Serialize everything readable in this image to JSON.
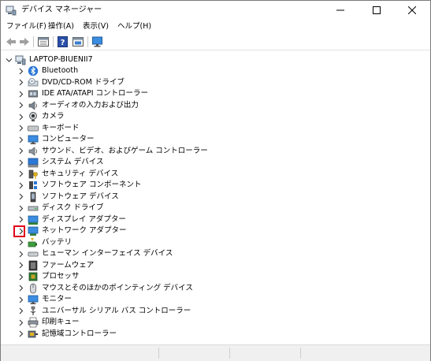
{
  "window": {
    "title": "デバイス マネージャー"
  },
  "menu": [
    {
      "label": "ファイル(F)"
    },
    {
      "label": "操作(A)"
    },
    {
      "label": "表示(V)"
    },
    {
      "label": "ヘルプ(H)"
    }
  ],
  "toolbar": {
    "icons": [
      "back-icon",
      "forward-icon",
      "properties-icon",
      "help-icon",
      "show-hidden-icon",
      "monitor-icon"
    ]
  },
  "tree": {
    "root": {
      "label": "LAPTOP-BIUENII7",
      "expanded": true
    },
    "categories": [
      {
        "label": "Bluetooth",
        "icon": "bluetooth-icon"
      },
      {
        "label": "DVD/CD-ROM ドライブ",
        "icon": "dvd-drive-icon"
      },
      {
        "label": "IDE ATA/ATAPI コントローラー",
        "icon": "ide-controller-icon"
      },
      {
        "label": "オーディオの入力および出力",
        "icon": "speaker-icon"
      },
      {
        "label": "カメラ",
        "icon": "camera-icon"
      },
      {
        "label": "キーボード",
        "icon": "keyboard-icon"
      },
      {
        "label": "コンピューター",
        "icon": "computer-icon"
      },
      {
        "label": "サウンド、ビデオ、およびゲーム コントローラー",
        "icon": "sound-icon"
      },
      {
        "label": "システム デバイス",
        "icon": "system-device-icon"
      },
      {
        "label": "セキュリティ デバイス",
        "icon": "security-device-icon"
      },
      {
        "label": "ソフトウェア コンポーネント",
        "icon": "software-component-icon"
      },
      {
        "label": "ソフトウェア デバイス",
        "icon": "software-device-icon"
      },
      {
        "label": "ディスク ドライブ",
        "icon": "disk-drive-icon"
      },
      {
        "label": "ディスプレイ アダプター",
        "icon": "display-adapter-icon"
      },
      {
        "label": "ネットワーク アダプター",
        "icon": "network-adapter-icon"
      },
      {
        "label": "バッテリ",
        "icon": "battery-icon"
      },
      {
        "label": "ヒューマン インターフェイス デバイス",
        "icon": "hid-icon"
      },
      {
        "label": "ファームウェア",
        "icon": "firmware-icon"
      },
      {
        "label": "プロセッサ",
        "icon": "processor-icon"
      },
      {
        "label": "マウスとそのほかのポインティング デバイス",
        "icon": "mouse-icon"
      },
      {
        "label": "モニター",
        "icon": "monitor-icon"
      },
      {
        "label": "ユニバーサル シリアル バス コントローラー",
        "icon": "usb-icon"
      },
      {
        "label": "印刷キュー",
        "icon": "printer-icon"
      },
      {
        "label": "記憶域コントローラー",
        "icon": "storage-controller-icon"
      }
    ],
    "highlighted_category": "ネットワーク アダプター"
  },
  "colors": {
    "highlight": "#e0001a",
    "accent_blue": "#2b78d6"
  }
}
